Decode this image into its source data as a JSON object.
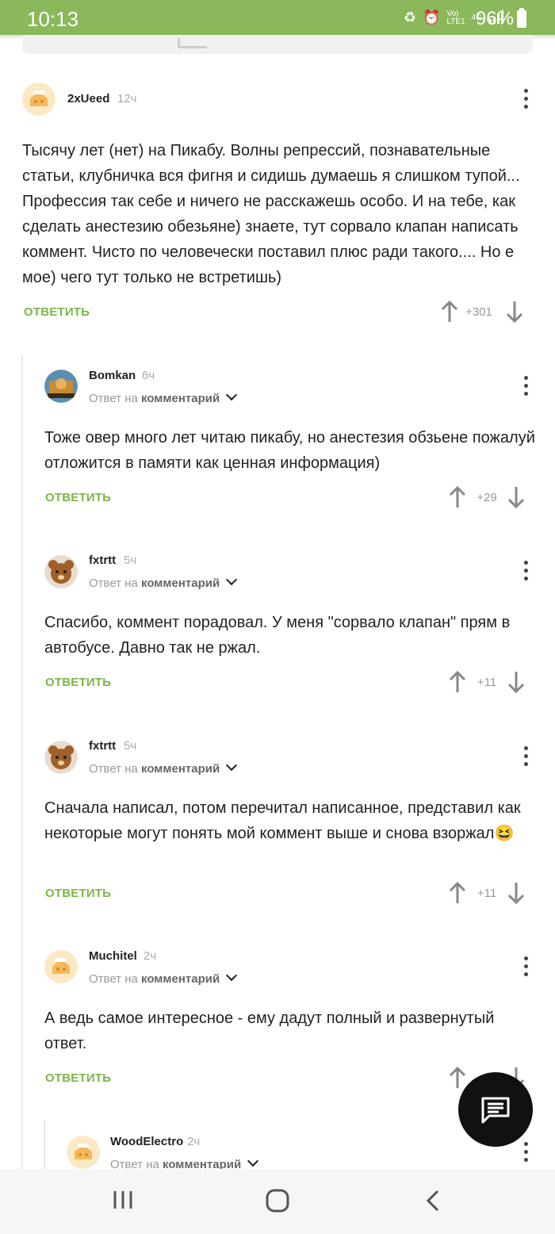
{
  "status": {
    "time": "10:13",
    "network_label_top": "Vo)",
    "network_label_bottom": "LTE1",
    "net_type": "4G",
    "battery": "96%"
  },
  "reply_action": "ОТВЕТИТЬ",
  "reply_prefix": "Ответ на",
  "reply_target": "комментарий",
  "comments": [
    {
      "author": "2xUeed",
      "time": "12ч",
      "text": "Тысячу лет (нет) на Пикабу. Волны репрессий, познавательные статьи, клубничка вся фигня и сидишь думаешь я слишком тупой... Профессия так себе и ничего не расскажешь особо. И на тебе, как сделать анестезию обезьяне) знаете, тут сорвало клапан написать коммент. Чисто по человечески поставил плюс ради такого.... Но е мое) чего тут только не встретишь)",
      "score": "+301"
    },
    {
      "author": "Bomkan",
      "time": "6ч",
      "text": "Тоже овер много лет читаю пикабу, но анестезия обзьене пожалуй отложится в памяти как ценная информация)",
      "score": "+29"
    },
    {
      "author": "fxtrtt",
      "time": "5ч",
      "text": "Спасибо, коммент порадовал. У меня \"сорвало клапан\" прям в автобусе. Давно так не ржал.",
      "score": "+11"
    },
    {
      "author": "fxtrtt",
      "time": "5ч",
      "text": "Сначала написал, потом перечитал написанное, представил как некоторые могут понять мой коммент выше и снова взоржал😆",
      "score": "+11"
    },
    {
      "author": "Muchitel",
      "time": "2ч",
      "text": "А ведь самое интересное - ему дадут полный и развернутый ответ.",
      "score": ""
    },
    {
      "author": "WoodElectro",
      "time": "2ч",
      "text": "",
      "score": ""
    }
  ],
  "icons": {
    "fab": "chat-compose-icon",
    "nav": [
      "recents-icon",
      "home-icon",
      "back-icon"
    ]
  },
  "colors": {
    "status_bar": "#8ab85a",
    "accent": "#7ab648"
  }
}
